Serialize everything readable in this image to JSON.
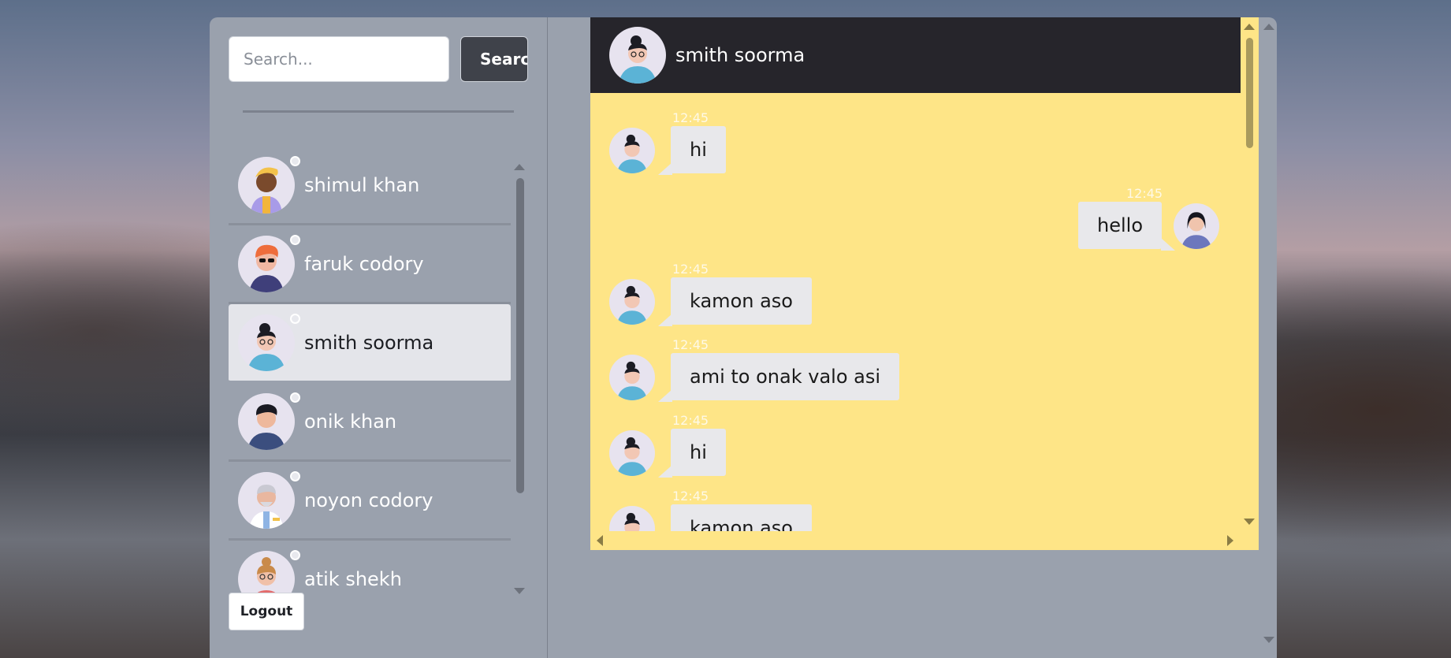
{
  "search": {
    "placeholder": "Search...",
    "button_label": "Search"
  },
  "contacts": [
    {
      "name": "shimul khan",
      "avatar": "woman-yellow-hair-avatar",
      "active": false
    },
    {
      "name": "faruk codory",
      "avatar": "man-orange-hair-sunglasses-avatar",
      "active": false
    },
    {
      "name": "smith soorma",
      "avatar": "man-curly-hair-glasses-avatar",
      "active": true
    },
    {
      "name": "onik khan",
      "avatar": "man-dark-hair-avatar",
      "active": false
    },
    {
      "name": "noyon codory",
      "avatar": "old-man-doctor-avatar",
      "active": false
    },
    {
      "name": "atik shekh",
      "avatar": "woman-bun-glasses-avatar",
      "active": false
    }
  ],
  "logout_label": "Logout",
  "chat": {
    "header_name": "smith soorma",
    "messages": [
      {
        "from": "them",
        "time": "12:45",
        "text": "hi"
      },
      {
        "from": "me",
        "time": "12:45",
        "text": "hello"
      },
      {
        "from": "them",
        "time": "12:45",
        "text": "kamon aso"
      },
      {
        "from": "them",
        "time": "12:45",
        "text": "ami to onak valo asi"
      },
      {
        "from": "them",
        "time": "12:45",
        "text": "hi"
      },
      {
        "from": "them",
        "time": "12:45",
        "text": "kamon aso"
      }
    ]
  },
  "colors": {
    "panel": "#9aa1ad",
    "chat_background": "#fee587",
    "chat_header": "#26252b",
    "bubble": "#e8e8eb",
    "search_button": "#3f424a"
  }
}
